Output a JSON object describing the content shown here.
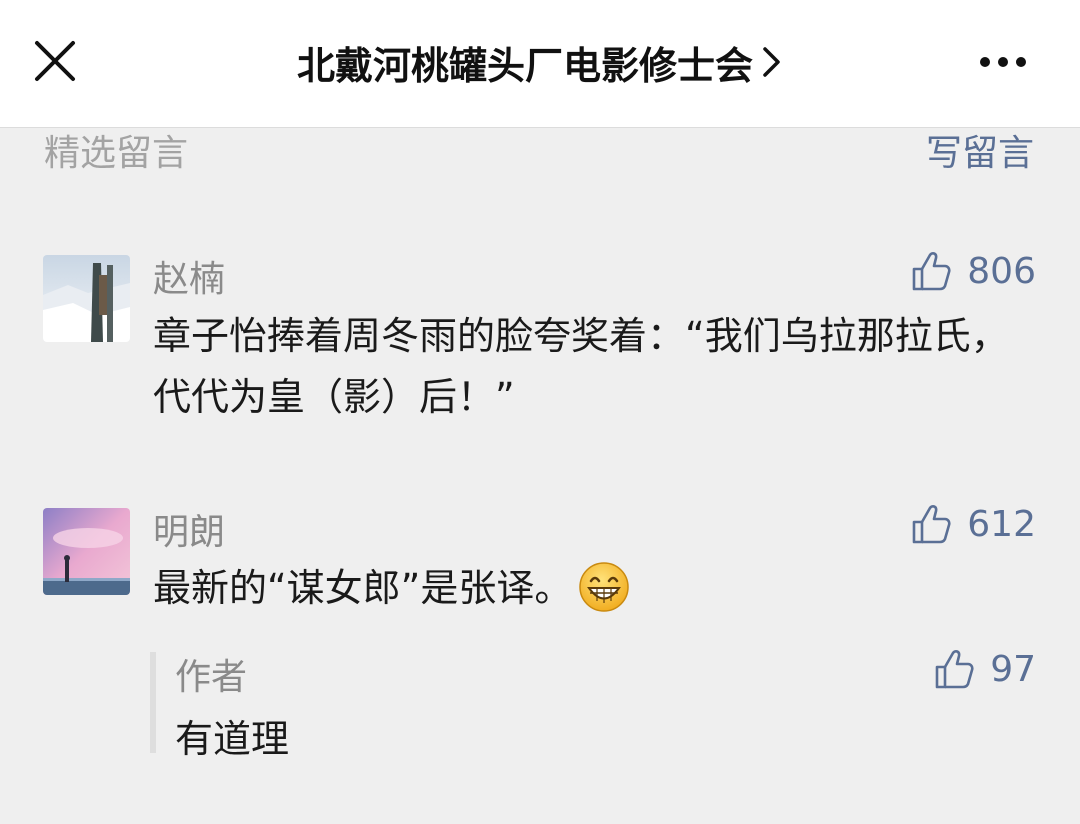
{
  "header": {
    "title": "北戴河桃罐头厂电影修士会",
    "close_icon": "close-icon",
    "chevron_icon": "chevron-right-icon",
    "more_icon": "more-dots-icon"
  },
  "section": {
    "label": "精选留言",
    "write_label": "写留言"
  },
  "comments": [
    {
      "nickname": "赵楠",
      "likes": "806",
      "content": "章子怡捧着周冬雨的脸夸奖着：“我们乌拉那拉氏，代代为皇（影）后！”"
    },
    {
      "nickname": "明朗",
      "likes": "612",
      "content": "最新的“谋女郎”是张译。",
      "emoji": "grinning-face-emoji",
      "reply": {
        "author": "作者",
        "likes": "97",
        "content": "有道理"
      }
    }
  ],
  "colors": {
    "link": "#5a6f95",
    "meta": "#8a8a8a",
    "background": "#efefef"
  }
}
